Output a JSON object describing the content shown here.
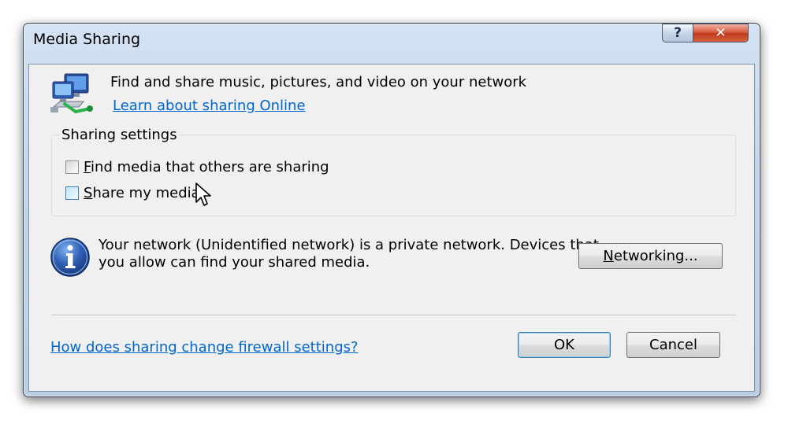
{
  "window": {
    "title": "Media Sharing",
    "help_glyph": "?",
    "close_glyph": "✕"
  },
  "header": {
    "icon": "network-computers-icon",
    "text": "Find and share music, pictures, and video on your network",
    "link": "Learn about sharing Online"
  },
  "sharing": {
    "group_label": "Sharing settings",
    "find_media": {
      "mnemonic": "F",
      "rest": "ind media that others are sharing",
      "checked": false
    },
    "share_media": {
      "mnemonic": "S",
      "rest": "hare my media",
      "checked": false
    }
  },
  "info": {
    "icon": "info-icon",
    "line1": "Your network (Unidentified network) is a private network. Devices that",
    "line2": "you allow can find your shared media."
  },
  "buttons": {
    "networking": {
      "mnemonic": "N",
      "rest": "etworking..."
    },
    "ok": "OK",
    "cancel": "Cancel"
  },
  "footer": {
    "firewall_link": "How does sharing change firewall settings?"
  },
  "colors": {
    "link": "#0066cc",
    "close_button": "#c8421f",
    "info_icon": "#2f5fb3"
  }
}
